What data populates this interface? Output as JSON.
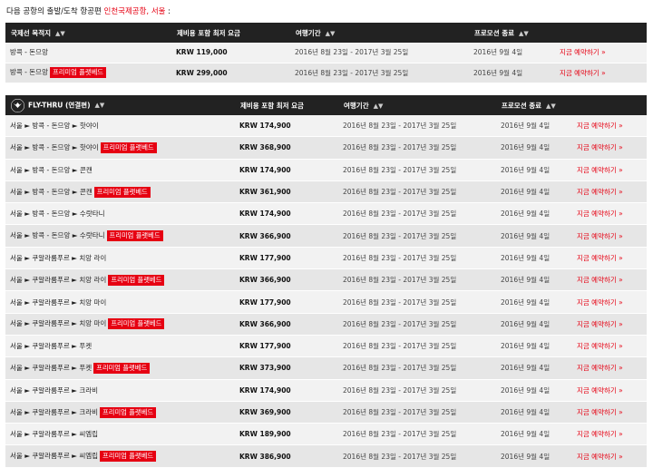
{
  "heading": {
    "prefix": "다음 공항의 출발/도착 항공편 ",
    "location": "인천국제공항, 서울",
    "suffix": " :"
  },
  "sort_icon": "sort-updown-icon",
  "route_arrow": "►",
  "premium_label": "프리미엄 플랫베드",
  "book_label": "지금 예약하기 »",
  "colors": {
    "accent": "#e60012",
    "header_bg": "#222222"
  },
  "table1": {
    "headers": [
      "국제선 목적지",
      "제비용 포함 최저 요금",
      "여행기간",
      "프로모션 종료"
    ],
    "rows": [
      {
        "route": [
          "방콕 - 돈므앙"
        ],
        "premium": false,
        "price": "KRW 119,000",
        "dates": "2016년 8월 23일 - 2017년 3월 25일",
        "promo_end": "2016년 9월 4일"
      },
      {
        "route": [
          "방콕 - 돈므앙"
        ],
        "premium": true,
        "price": "KRW 299,000",
        "dates": "2016년 8월 23일 - 2017년 3월 25일",
        "promo_end": "2016년 9월 4일"
      }
    ]
  },
  "table2": {
    "logo_icon": "fly-thru-logo-icon",
    "headers": [
      "FLY-THRU (연결편)",
      "제비용 포함 최저 요금",
      "여행기간",
      "프로모션 종료"
    ],
    "rows": [
      {
        "route": [
          "서울",
          "방콕 - 돈므앙",
          "핫야이"
        ],
        "premium": false,
        "price": "KRW 174,900",
        "dates": "2016년 8월 23일 - 2017년 3월 25일",
        "promo_end": "2016년 9월 4일"
      },
      {
        "route": [
          "서울",
          "방콕 - 돈므앙",
          "핫야이"
        ],
        "premium": true,
        "price": "KRW 368,900",
        "dates": "2016년 8월 23일 - 2017년 3월 25일",
        "promo_end": "2016년 9월 4일"
      },
      {
        "route": [
          "서울",
          "방콕 - 돈므앙",
          "콘캔"
        ],
        "premium": false,
        "price": "KRW 174,900",
        "dates": "2016년 8월 23일 - 2017년 3월 25일",
        "promo_end": "2016년 9월 4일"
      },
      {
        "route": [
          "서울",
          "방콕 - 돈므앙",
          "콘캔"
        ],
        "premium": true,
        "price": "KRW 361,900",
        "dates": "2016년 8월 23일 - 2017년 3월 25일",
        "promo_end": "2016년 9월 4일"
      },
      {
        "route": [
          "서울",
          "방콕 - 돈므앙",
          "수랏타니"
        ],
        "premium": false,
        "price": "KRW 174,900",
        "dates": "2016년 8월 23일 - 2017년 3월 25일",
        "promo_end": "2016년 9월 4일"
      },
      {
        "route": [
          "서울",
          "방콕 - 돈므앙",
          "수랏타니"
        ],
        "premium": true,
        "price": "KRW 366,900",
        "dates": "2016년 8월 23일 - 2017년 3월 25일",
        "promo_end": "2016년 9월 4일"
      },
      {
        "route": [
          "서울",
          "쿠알라룸푸르",
          "치앙 라이"
        ],
        "premium": false,
        "price": "KRW 177,900",
        "dates": "2016년 8월 23일 - 2017년 3월 25일",
        "promo_end": "2016년 9월 4일"
      },
      {
        "route": [
          "서울",
          "쿠알라룸푸르",
          "치앙 라이"
        ],
        "premium": true,
        "price": "KRW 366,900",
        "dates": "2016년 8월 23일 - 2017년 3월 25일",
        "promo_end": "2016년 9월 4일"
      },
      {
        "route": [
          "서울",
          "쿠알라룸푸르",
          "치앙 마이"
        ],
        "premium": false,
        "price": "KRW 177,900",
        "dates": "2016년 8월 23일 - 2017년 3월 25일",
        "promo_end": "2016년 9월 4일"
      },
      {
        "route": [
          "서울",
          "쿠알라룸푸르",
          "치앙 마이"
        ],
        "premium": true,
        "price": "KRW 366,900",
        "dates": "2016년 8월 23일 - 2017년 3월 25일",
        "promo_end": "2016년 9월 4일"
      },
      {
        "route": [
          "서울",
          "쿠알라룸푸르",
          "푸켓"
        ],
        "premium": false,
        "price": "KRW 177,900",
        "dates": "2016년 8월 23일 - 2017년 3월 25일",
        "promo_end": "2016년 9월 4일"
      },
      {
        "route": [
          "서울",
          "쿠알라룸푸르",
          "푸켓"
        ],
        "premium": true,
        "price": "KRW 373,900",
        "dates": "2016년 8월 23일 - 2017년 3월 25일",
        "promo_end": "2016년 9월 4일"
      },
      {
        "route": [
          "서울",
          "쿠알라룸푸르",
          "크라비"
        ],
        "premium": false,
        "price": "KRW 174,900",
        "dates": "2016년 8월 23일 - 2017년 3월 25일",
        "promo_end": "2016년 9월 4일"
      },
      {
        "route": [
          "서울",
          "쿠알라룸푸르",
          "크라비"
        ],
        "premium": true,
        "price": "KRW 369,900",
        "dates": "2016년 8월 23일 - 2017년 3월 25일",
        "promo_end": "2016년 9월 4일"
      },
      {
        "route": [
          "서울",
          "쿠알라룸푸르",
          "씨엠립"
        ],
        "premium": false,
        "price": "KRW 189,900",
        "dates": "2016년 8월 23일 - 2017년 3월 25일",
        "promo_end": "2016년 9월 4일"
      },
      {
        "route": [
          "서울",
          "쿠알라룸푸르",
          "씨엠립"
        ],
        "premium": true,
        "price": "KRW 386,900",
        "dates": "2016년 8월 23일 - 2017년 3월 25일",
        "promo_end": "2016년 9월 4일"
      }
    ]
  }
}
